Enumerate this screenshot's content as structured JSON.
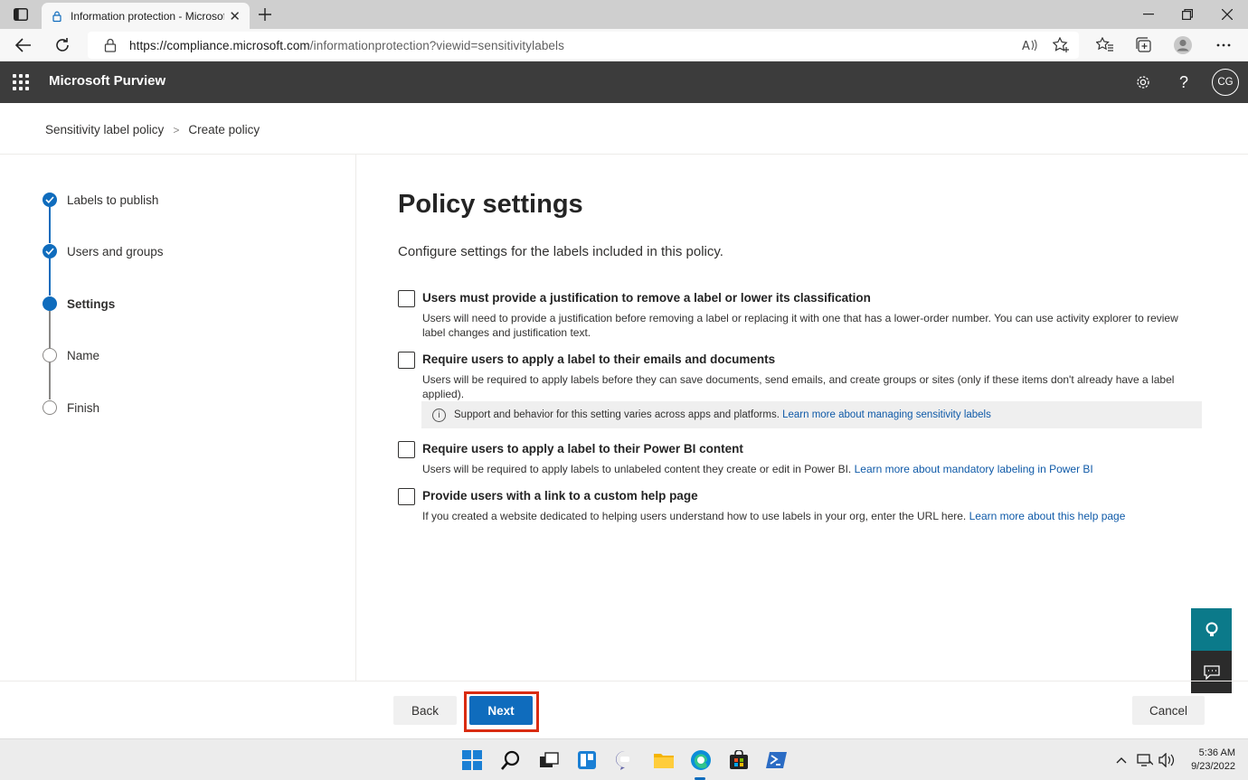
{
  "browser": {
    "tab_title": "Information protection - Microsoft Purview",
    "url_host": "https://compliance.microsoft.com",
    "url_path": "/informationprotection?viewid=sensitivitylabels"
  },
  "app": {
    "title": "Microsoft Purview",
    "avatar_initials": "CG"
  },
  "breadcrumb": {
    "item1": "Sensitivity label policy",
    "item2": "Create policy"
  },
  "steps": [
    {
      "label": "Labels to publish",
      "state": "done"
    },
    {
      "label": "Users and groups",
      "state": "done"
    },
    {
      "label": "Settings",
      "state": "current"
    },
    {
      "label": "Name",
      "state": "todo"
    },
    {
      "label": "Finish",
      "state": "todo"
    }
  ],
  "main": {
    "heading": "Policy settings",
    "intro": "Configure settings for the labels included in this policy.",
    "options": [
      {
        "title": "Users must provide a justification to remove a label or lower its classification",
        "desc": "Users will need to provide a justification before removing a label or replacing it with one that has a lower-order number. You can use activity explorer to review label changes and justification text.",
        "checked": false
      },
      {
        "title": "Require users to apply a label to their emails and documents",
        "desc": "Users will be required to apply labels before they can save documents, send emails, and create groups or sites (only if these items don't already have a label applied).",
        "checked": false
      },
      {
        "title": "Require users to apply a label to their Power BI content",
        "desc": "Users will be required to apply labels to unlabeled content they create or edit in Power BI.",
        "link": "Learn more about mandatory labeling in Power BI",
        "checked": false
      },
      {
        "title": "Provide users with a link to a custom help page",
        "desc": "If you created a website dedicated to helping users understand how to use labels in your org, enter the URL here.",
        "link": "Learn more about this help page",
        "checked": false
      }
    ],
    "info_text": "Support and behavior for this setting varies across apps and platforms.",
    "info_link": "Learn more about managing sensitivity labels"
  },
  "footer": {
    "back": "Back",
    "next": "Next",
    "cancel": "Cancel"
  },
  "taskbar": {
    "time": "5:36 AM",
    "date": "9/23/2022"
  },
  "colors": {
    "accent": "#0f6cbd",
    "header_bg": "#3c3c3c",
    "highlight": "#d92c12"
  }
}
